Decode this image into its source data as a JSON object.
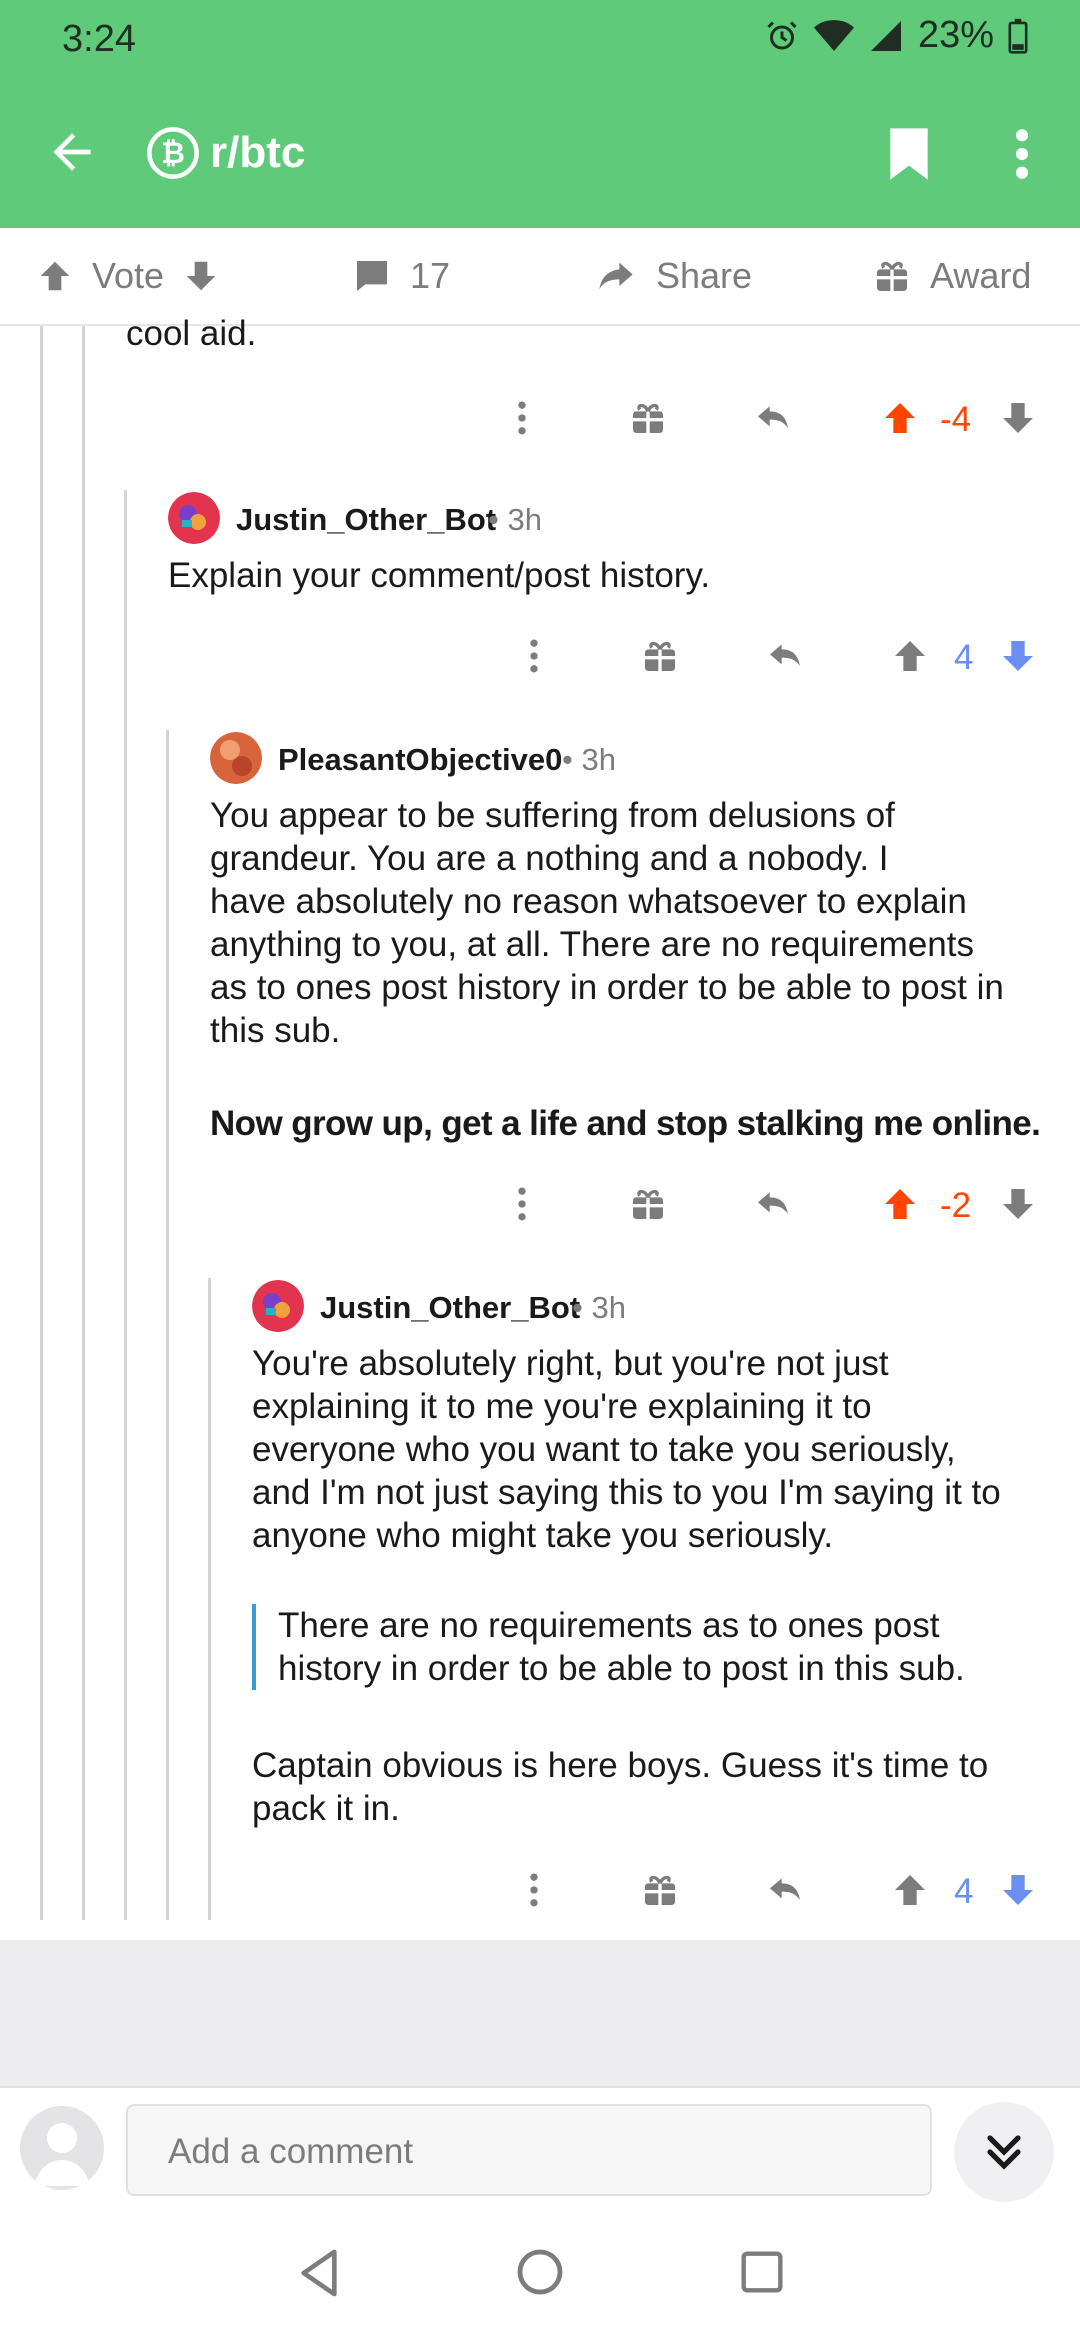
{
  "status": {
    "time": "3:24",
    "battery": "23%"
  },
  "appbar": {
    "subreddit": "r/btc"
  },
  "votebar": {
    "vote": "Vote",
    "comments": "17",
    "share": "Share",
    "award": "Award"
  },
  "thread": {
    "prev_tail": "cool aid.",
    "prev_score": "-4",
    "c1": {
      "author": "Justin_Other_Bot",
      "age": "3h",
      "body": "Explain your comment/post history.",
      "score": "4"
    },
    "c2": {
      "author": "PleasantObjective0",
      "age": "3h",
      "body_lines": [
        "You appear to be suffering from delusions of",
        "grandeur.  You are a nothing and a nobody.  I",
        "have absolutely no reason whatsoever to explain",
        "anything to you, at all.  There are no requirements",
        "as to ones post history in order to be able to post in",
        "this sub."
      ],
      "bold_line": "Now grow up, get a life and stop stalking me online.",
      "score": "-2"
    },
    "c3": {
      "author": "Justin_Other_Bot",
      "age": "3h",
      "body_lines": [
        "You're absolutely right, but you're not just",
        "explaining it to me you're explaining it to",
        "everyone who you want to take you seriously,",
        "and I'm not just saying this to you I'm saying it to",
        "anyone who might take you seriously."
      ],
      "quote_lines": [
        "There are no requirements as to ones post",
        "history in order to be able to post in this sub."
      ],
      "tail_lines": [
        "Captain obvious is here boys. Guess it's time to",
        "pack it in."
      ],
      "score": "4"
    }
  },
  "composer": {
    "placeholder": "Add a comment"
  },
  "colors": {
    "header": "#5fcb7a",
    "upvote": "#ff4500",
    "downvote": "#6a8ff0",
    "quote_bar": "#3b9bd6"
  }
}
